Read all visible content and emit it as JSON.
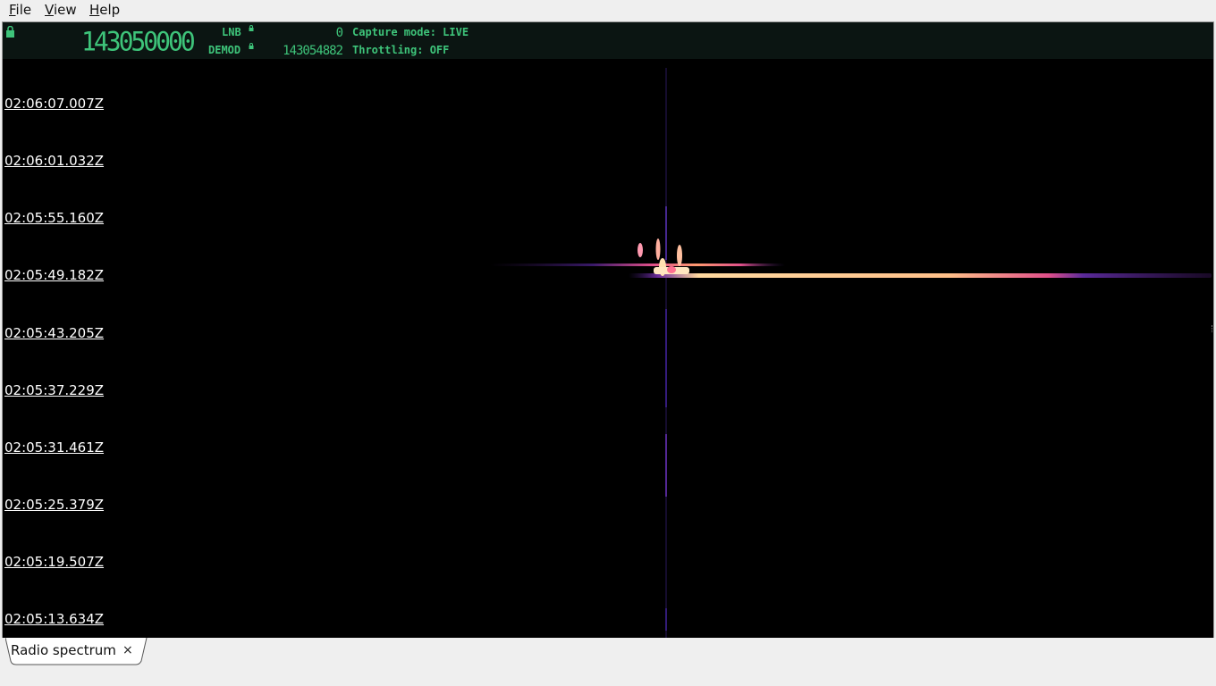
{
  "menu": {
    "file": {
      "accel": "F",
      "rest": "ile"
    },
    "view": {
      "accel": "V",
      "rest": "iew"
    },
    "help": {
      "accel": "H",
      "rest": "elp"
    }
  },
  "status": {
    "main_frequency": "143050000",
    "lnb_label": "LNB",
    "lnb_value": "0",
    "demod_label": "DEMOD",
    "demod_value": "143054882",
    "capture_mode": "Capture mode: LIVE",
    "throttling": "Throttling: OFF"
  },
  "waterfall": {
    "timestamps": [
      "02:06:07.007Z",
      "02:06:01.032Z",
      "02:05:55.160Z",
      "02:05:49.182Z",
      "02:05:43.205Z",
      "02:05:37.229Z",
      "02:05:31.461Z",
      "02:05:25.379Z",
      "02:05:19.507Z",
      "02:05:13.634Z"
    ]
  },
  "tabs": [
    {
      "label": "Radio spectrum",
      "close": "×"
    }
  ],
  "colors": {
    "display_green": "#3ec47a",
    "background": "#000000",
    "signal_hot": "#ffd9a0",
    "signal_mid": "#e0508a",
    "signal_low": "#5a2a9a"
  }
}
